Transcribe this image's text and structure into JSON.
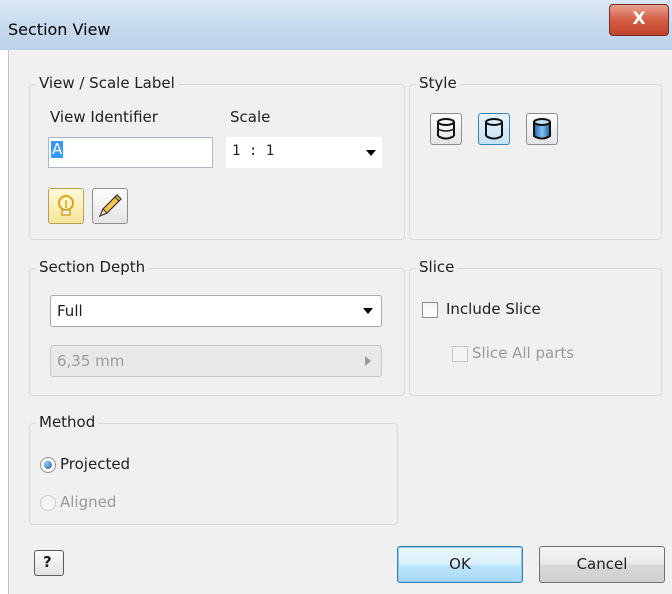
{
  "window": {
    "title": "Section View",
    "close_glyph": "X"
  },
  "view_scale": {
    "legend": "View / Scale Label",
    "view_identifier_label": "View Identifier",
    "view_identifier_value": "A",
    "scale_label": "Scale",
    "scale_value": "1 : 1",
    "icons": [
      "lightbulb-icon",
      "pencil-icon"
    ]
  },
  "style": {
    "legend": "Style",
    "buttons": [
      "hidden-lines-style-icon",
      "hidden-lines-removed-style-icon",
      "shaded-style-icon"
    ],
    "active_index": 1
  },
  "section_depth": {
    "legend": "Section Depth",
    "depth_value": "Full",
    "distance_value": "6,35 mm"
  },
  "slice": {
    "legend": "Slice",
    "include_slice_label": "Include Slice",
    "include_slice_checked": false,
    "slice_all_label": "Slice All parts",
    "slice_all_checked": false
  },
  "method": {
    "legend": "Method",
    "projected_label": "Projected",
    "aligned_label": "Aligned",
    "selected": "Projected"
  },
  "footer": {
    "help_glyph": "?",
    "ok_label": "OK",
    "cancel_label": "Cancel"
  },
  "colors": {
    "accent": "#3399ff",
    "default_button": "#3c7fb1"
  }
}
